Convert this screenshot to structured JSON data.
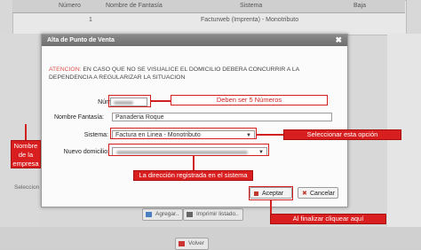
{
  "background": {
    "table_headers": [
      "Número",
      "Nombre de Fantasía",
      "Sistema",
      "Baja"
    ],
    "row": {
      "numero": "1",
      "sistema": "Facturweb (Imprenta) - Monotributo"
    },
    "left_label": "Seleccion",
    "buttons": {
      "agregar": "Agregar..",
      "imprimir": "Imprimir listado.."
    },
    "volver": "Volver"
  },
  "modal": {
    "title": "Alta de Punto de Venta",
    "close": "✖",
    "warning_prefix": "ATENCION:",
    "warning_text": " EN CASO QUE NO SE VISUALICE EL DOMICILIO DEBERA CONCURRIR A LA DEPENDENCIA A REGULARIZAR LA SITUACION",
    "fields": {
      "numero_label": "Número:",
      "fantasia_label": "Nombre Fantasía:",
      "fantasia_value": "Panaderia Roque",
      "sistema_label": "Sistema:",
      "sistema_value": "Factura en Linea - Monotributo",
      "domicilio_label": "Nuevo domicilio:"
    },
    "buttons": {
      "aceptar": "Aceptar",
      "cancelar": "Cancelar"
    }
  },
  "annotations": {
    "numero": "Deben ser 5 Números",
    "nombre": "Nombre de la empresa",
    "sistema": "Seleccionar esta opción",
    "domicilio": "La dirección registrada en el sistema",
    "aceptar": "Al finalizar cliquear aquí"
  },
  "colors": {
    "annotation": "#d21f1f",
    "header": "#7c7c7c"
  }
}
